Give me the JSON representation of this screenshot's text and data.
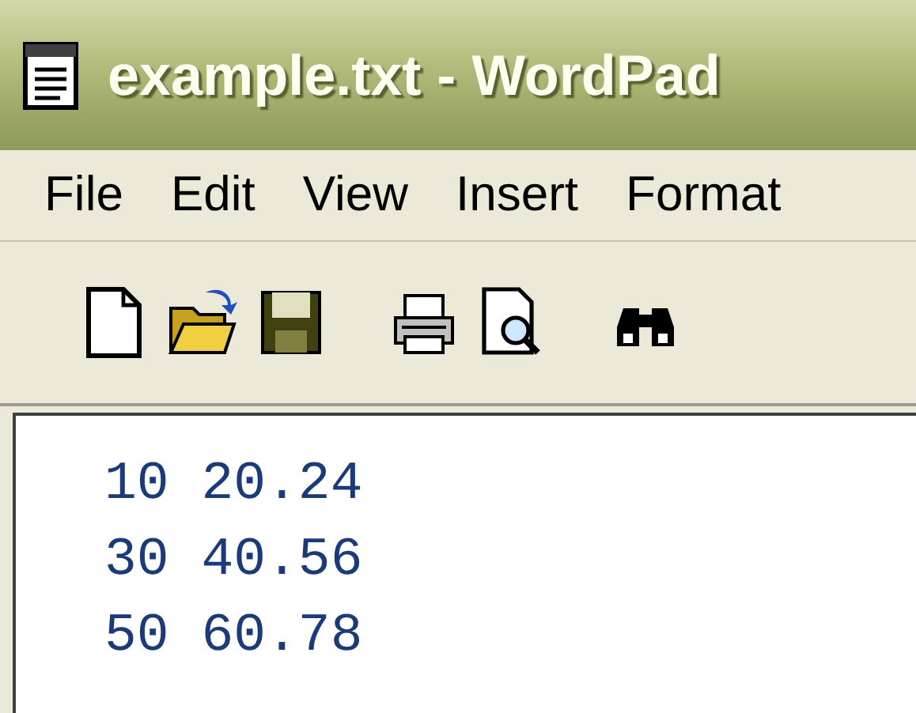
{
  "window": {
    "title": "example.txt - WordPad"
  },
  "menu": [
    "File",
    "Edit",
    "View",
    "Insert",
    "Format"
  ],
  "toolbar": [
    {
      "kind": "new"
    },
    {
      "kind": "open"
    },
    {
      "kind": "save"
    },
    {
      "kind": "print"
    },
    {
      "kind": "preview"
    },
    {
      "kind": "find"
    }
  ],
  "document": {
    "lines": [
      "10 20.24",
      "30 40.56",
      "50 60.78"
    ]
  }
}
